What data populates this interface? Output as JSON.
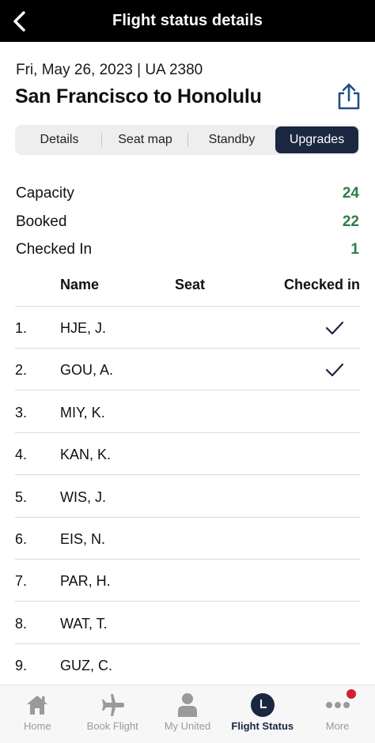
{
  "header": {
    "title": "Flight status details"
  },
  "flight": {
    "meta": "Fri, May 26, 2023 | UA 2380",
    "route": "San Francisco to Honolulu"
  },
  "tabs": [
    {
      "label": "Details"
    },
    {
      "label": "Seat map"
    },
    {
      "label": "Standby"
    },
    {
      "label": "Upgrades",
      "active": true
    }
  ],
  "stats": [
    {
      "label": "Capacity",
      "value": "24"
    },
    {
      "label": "Booked",
      "value": "22"
    },
    {
      "label": "Checked In",
      "value": "1"
    }
  ],
  "table": {
    "columns": [
      "Name",
      "Seat",
      "Checked in"
    ],
    "rows": [
      {
        "num": "1.",
        "name": "HJE, J.",
        "seat": "",
        "checked_in": true
      },
      {
        "num": "2.",
        "name": "GOU, A.",
        "seat": "",
        "checked_in": true
      },
      {
        "num": "3.",
        "name": "MIY, K.",
        "seat": "",
        "checked_in": false
      },
      {
        "num": "4.",
        "name": "KAN, K.",
        "seat": "",
        "checked_in": false
      },
      {
        "num": "5.",
        "name": "WIS, J.",
        "seat": "",
        "checked_in": false
      },
      {
        "num": "6.",
        "name": "EIS, N.",
        "seat": "",
        "checked_in": false
      },
      {
        "num": "7.",
        "name": "PAR, H.",
        "seat": "",
        "checked_in": false
      },
      {
        "num": "8.",
        "name": "WAT, T.",
        "seat": "",
        "checked_in": false
      },
      {
        "num": "9.",
        "name": "GUZ, C.",
        "seat": "",
        "checked_in": false
      }
    ]
  },
  "bottom_nav": [
    {
      "label": "Home",
      "icon": "home-icon"
    },
    {
      "label": "Book Flight",
      "icon": "plane-icon"
    },
    {
      "label": "My United",
      "icon": "person-icon"
    },
    {
      "label": "Flight Status",
      "icon": "clock-icon",
      "active": true
    },
    {
      "label": "More",
      "icon": "more-dots-icon",
      "badge": true
    }
  ],
  "colors": {
    "accent": "#1b2740",
    "stat_value": "#2e7d4a",
    "badge": "#d3202f",
    "header_bg": "#000000"
  }
}
